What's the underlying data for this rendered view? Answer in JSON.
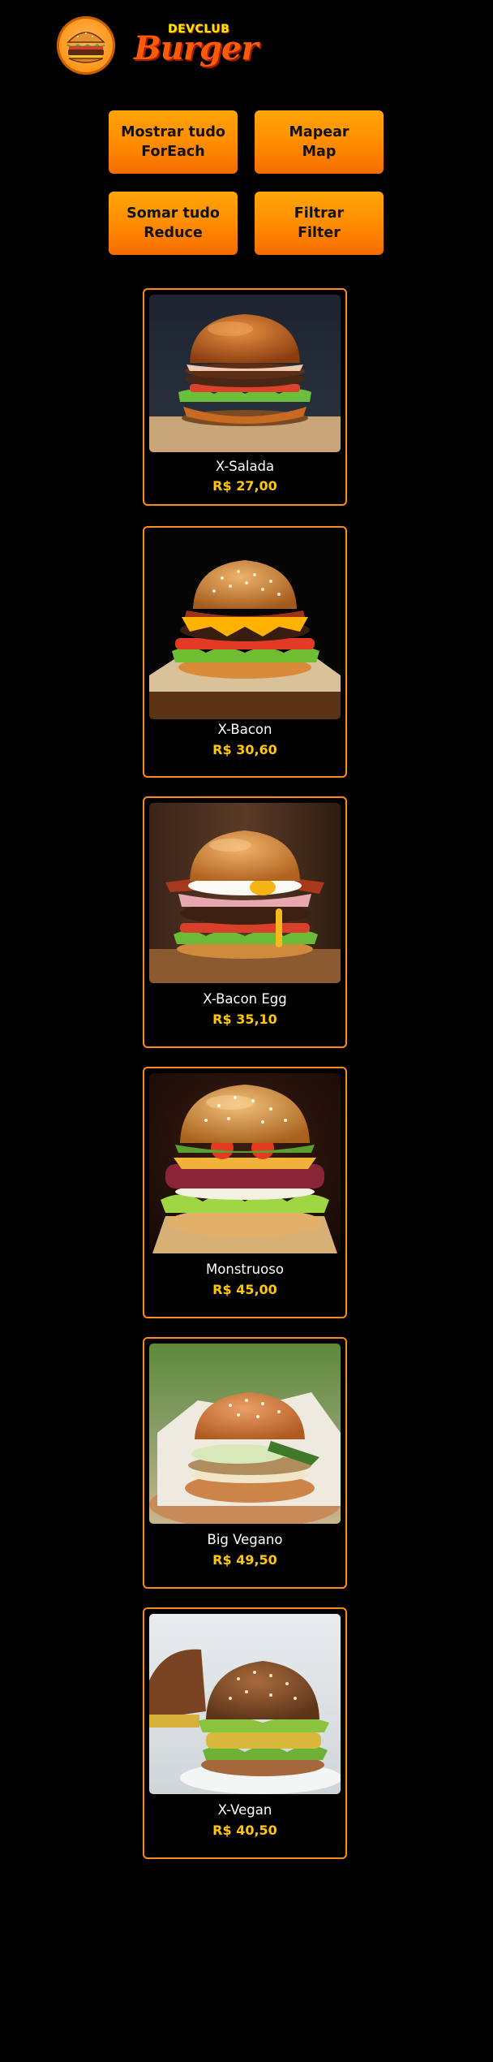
{
  "header": {
    "brand_top": "DEVCLUB",
    "brand_main": "Burger",
    "logo_icon": "burger-icon"
  },
  "actions": [
    {
      "line1": "Mostrar tudo",
      "line2": "ForEach"
    },
    {
      "line1": "Mapear",
      "line2": "Map"
    },
    {
      "line1": "Somar tudo",
      "line2": "Reduce"
    },
    {
      "line1": "Filtrar",
      "line2": "Filter"
    }
  ],
  "products": [
    {
      "name": "X-Salada",
      "price": "R$ 27,00",
      "image": "burger-photo"
    },
    {
      "name": "X-Bacon",
      "price": "R$ 30,60",
      "image": "burger-photo"
    },
    {
      "name": "X-Bacon Egg",
      "price": "R$ 35,10",
      "image": "burger-photo"
    },
    {
      "name": "Monstruoso",
      "price": "R$ 45,00",
      "image": "burger-photo"
    },
    {
      "name": "Big Vegano",
      "price": "R$ 49,50",
      "image": "burger-photo"
    },
    {
      "name": "X-Vegan",
      "price": "R$ 40,50",
      "image": "burger-photo"
    }
  ],
  "colors": {
    "background": "#000000",
    "accent": "#ff8a00",
    "price": "#ffc60a",
    "card_border": "#ff8a1a"
  }
}
